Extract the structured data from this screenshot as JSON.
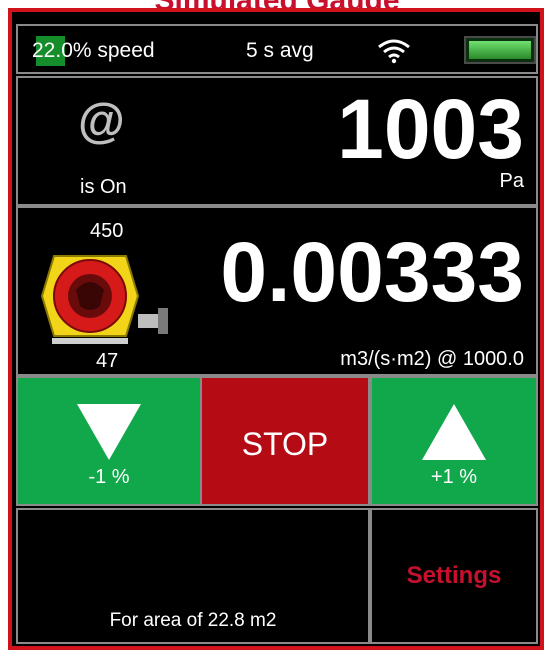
{
  "app": {
    "title": "Simulated Gauge"
  },
  "status": {
    "speed_text": "22.0% speed",
    "speed_fraction": 0.22,
    "avg_text": "5 s avg",
    "wifi_icon": "wifi-icon",
    "battery_icon": "battery-icon",
    "battery_level": 1.0
  },
  "pressure": {
    "icon": "at-icon",
    "status": "is On",
    "value": "1003",
    "unit": "Pa"
  },
  "flow": {
    "gauge_top": "450",
    "gauge_bottom": "47",
    "value": "0.00333",
    "unit": "m3/(s·m2) @ 1000.0"
  },
  "controls": {
    "down_label": "-1  %",
    "stop_label": "STOP",
    "up_label": "+1  %",
    "settings_label": "Settings"
  },
  "area": {
    "text": "For area of 22.8 m2"
  },
  "colors": {
    "accent_red": "#c8102e",
    "button_green": "#11a84c",
    "stop_red": "#b40b14",
    "speed_green": "#158d2a"
  }
}
